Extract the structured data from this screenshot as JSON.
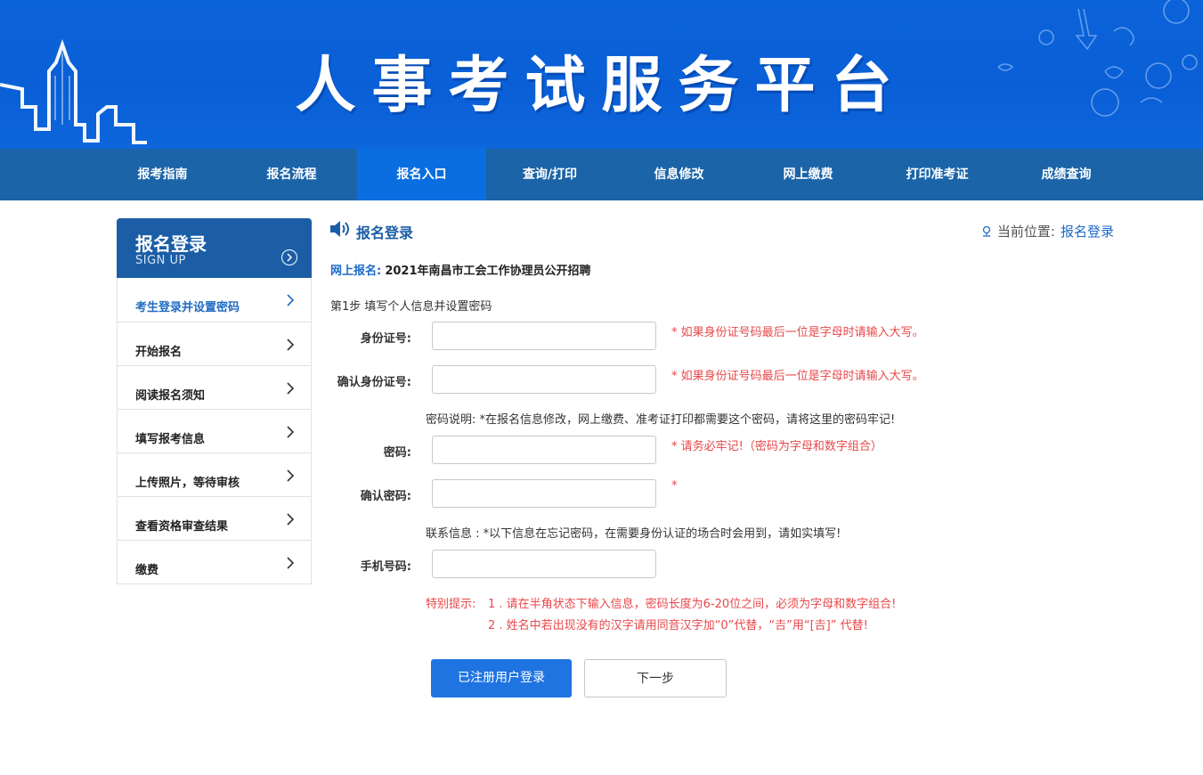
{
  "banner": {
    "title": "人事考试服务平台"
  },
  "nav": {
    "items": [
      {
        "label": "报考指南"
      },
      {
        "label": "报名流程"
      },
      {
        "label": "报名入口"
      },
      {
        "label": "查询/打印"
      },
      {
        "label": "信息修改"
      },
      {
        "label": "网上缴费"
      },
      {
        "label": "打印准考证"
      },
      {
        "label": "成绩查询"
      }
    ],
    "active": "报名入口"
  },
  "sidebar": {
    "title": "报名登录",
    "subtitle": "SIGN UP",
    "items": [
      {
        "label": "考生登录并设置密码"
      },
      {
        "label": "开始报名"
      },
      {
        "label": "阅读报名须知"
      },
      {
        "label": "填写报考信息"
      },
      {
        "label": "上传照片，等待审核"
      },
      {
        "label": "查看资格审查结果"
      },
      {
        "label": "缴费"
      }
    ]
  },
  "main": {
    "title": "报名登录",
    "location_label": "当前位置:",
    "location_value": "报名登录",
    "exam_key": "网上报名:",
    "exam_value": "2021年南昌市工会工作协理员公开招聘",
    "step": "第1步 填写个人信息并设置密码"
  },
  "form": {
    "id_label": "身份证号:",
    "id_hint": "* 如果身份证号码最后一位是字母时请输入大写。",
    "id_confirm_label": "确认身份证号:",
    "id_confirm_hint": "* 如果身份证号码最后一位是字母时请输入大写。",
    "password_note": "密码说明: *在报名信息修改，网上缴费、准考证打印都需要这个密码，请将这里的密码牢记!",
    "password_label": "密码:",
    "password_hint": "* 请务必牢记!（密码为字母和数字组合）",
    "password_confirm_label": "确认密码:",
    "password_confirm_hint": "*",
    "contact_note": "联系信息 : *以下信息在忘记密码，在需要身份认证的场合时会用到，请如实填写!",
    "phone_label": "手机号码:"
  },
  "tips": {
    "prefix": "特别提示:",
    "tip1": "1 . 请在半角状态下输入信息，密码长度为6-20位之间，必须为字母和数字组合!",
    "tip2": "2 . 姓名中若出现没有的汉字请用同音汉字加“0”代替，“𠮷”用“[𠮷]” 代替!"
  },
  "buttons": {
    "login": "已注册用户登录",
    "next": "下一步"
  },
  "colors": {
    "banner_blue": "#0b63d9",
    "nav_bg": "#1b64a8",
    "nav_active": "#0b6ee0",
    "accent": "#1b6bc7",
    "hint_red": "#e8474a",
    "primary_button": "#2074e1"
  }
}
